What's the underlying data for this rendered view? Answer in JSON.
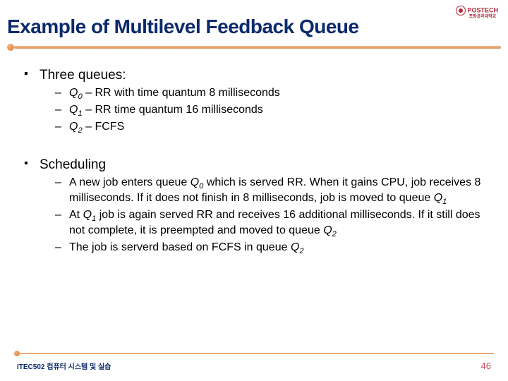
{
  "logo": {
    "text": "POSTECH",
    "sub": "포항공과대학교"
  },
  "title": "Example of Multilevel Feedback Queue",
  "sections": [
    {
      "heading": "Three queues:",
      "items": [
        {
          "prefix": "Q",
          "sub": "0",
          "rest": " – RR with time quantum 8 milliseconds"
        },
        {
          "prefix": "Q",
          "sub": "1",
          "rest": " – RR time quantum 16 milliseconds"
        },
        {
          "prefix": "Q",
          "sub": "2",
          "rest": " – FCFS"
        }
      ]
    },
    {
      "heading": "Scheduling",
      "items": [
        {
          "text_a": "A new job enters queue ",
          "q": "Q",
          "qsub": "0",
          "text_b": " which is served RR. When it gains CPU, job receives 8 milliseconds.  If it does not finish in 8 milliseconds, job is moved to queue ",
          "q2": "Q",
          "q2sub": "1"
        },
        {
          "text_a": "At ",
          "q": "Q",
          "qsub": "1",
          "text_b": " job is again served RR and receives 16 additional milliseconds.  If it still does not complete, it is preempted and moved to queue ",
          "q2": "Q",
          "q2sub": "2"
        },
        {
          "text_a": "The job is serverd based on FCFS in queue ",
          "q": "Q",
          "qsub": "2",
          "text_b": ""
        }
      ]
    }
  ],
  "footer": {
    "course": "ITEC502 컴퓨터 시스템 및 실습",
    "page": "46"
  }
}
